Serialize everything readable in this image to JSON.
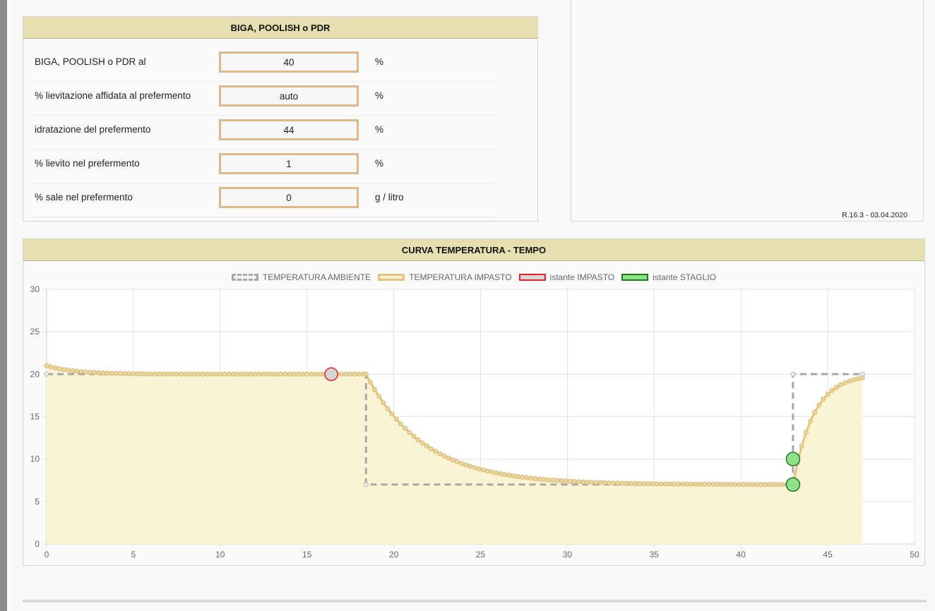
{
  "preferment": {
    "title": "BIGA, POOLISH o PDR",
    "rows": [
      {
        "label": "BIGA, POOLISH o PDR al",
        "value": "40",
        "unit": "%"
      },
      {
        "label": "% lievitazione affidata al prefermento",
        "value": "auto",
        "unit": "%"
      },
      {
        "label": "idratazione del prefermento",
        "value": "44",
        "unit": "%"
      },
      {
        "label": "% lievito nel prefermento",
        "value": "1",
        "unit": "%"
      },
      {
        "label": "% sale nel prefermento",
        "value": "0",
        "unit": "g / litro"
      }
    ]
  },
  "info_panel": {
    "version": "R.16.3 - 03.04.2020"
  },
  "chart_panel": {
    "title": "CURVA TEMPERATURA - TEMPO"
  },
  "colors": {
    "header_bg": "#e6e0b0",
    "input_border": "#ddb98a",
    "ambient_line": "#a8a8a8",
    "impasto_line": "#e3c47e",
    "impasto_fill": "#fbf4d4",
    "marker_impasto_fill": "#d6d6d6",
    "marker_impasto_border": "#e0202a",
    "marker_staglio_fill": "#8fe08a",
    "marker_staglio_border": "#1c7a1c"
  },
  "chart_data": {
    "type": "line",
    "xlim": [
      0,
      50
    ],
    "ylim": [
      0,
      30
    ],
    "x_ticks": [
      "0",
      "5",
      "10",
      "15",
      "20",
      "25",
      "30",
      "35",
      "40",
      "45",
      "50"
    ],
    "y_ticks": [
      "0",
      "5",
      "10",
      "15",
      "20",
      "25",
      "30"
    ],
    "grid": true,
    "legend_position": "top",
    "legend": [
      {
        "label": "TEMPERATURA AMBIENTE",
        "style": "dashed-gray"
      },
      {
        "label": "TEMPERATURA IMPASTO",
        "style": "solid-tan"
      },
      {
        "label": "istante IMPASTO",
        "style": "gray-red"
      },
      {
        "label": "istante STAGLIO",
        "style": "green"
      }
    ],
    "series": [
      {
        "name": "TEMPERATURA AMBIENTE",
        "points": [
          [
            0,
            20
          ],
          [
            18.4,
            20
          ],
          [
            18.4,
            7
          ],
          [
            43,
            7
          ],
          [
            43,
            20
          ],
          [
            47,
            20
          ]
        ]
      },
      {
        "name": "TEMPERATURA IMPASTO",
        "model": {
          "start": 21,
          "phases": [
            {
              "from": 0,
              "to": 18.4,
              "ambient": 20,
              "k": 0.6
            },
            {
              "from": 18.4,
              "to": 43,
              "ambient": 7,
              "k": 0.3
            },
            {
              "from": 43,
              "to": 47,
              "ambient": 20,
              "k": 0.85
            }
          ]
        }
      },
      {
        "name": "istante IMPASTO",
        "points": [
          [
            16.4,
            20
          ]
        ]
      },
      {
        "name": "istante STAGLIO",
        "points": [
          [
            43,
            10
          ],
          [
            43,
            7
          ]
        ]
      }
    ]
  }
}
